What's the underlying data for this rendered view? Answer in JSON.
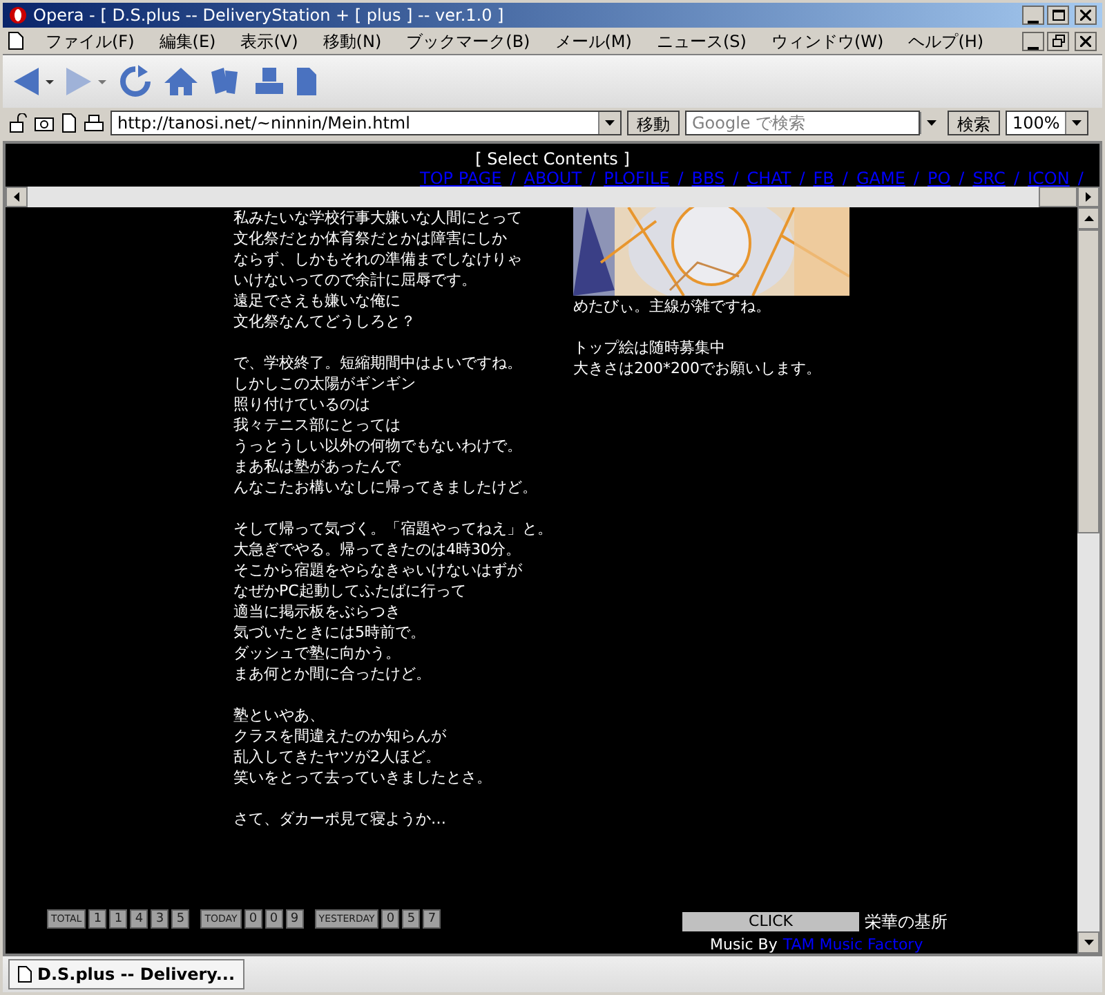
{
  "window": {
    "title": "Opera - [ D.S.plus -- DeliveryStation + [ plus ] -- ver.1.0 ]"
  },
  "menu": [
    "ファイル(F)",
    "編集(E)",
    "表示(V)",
    "移動(N)",
    "ブックマーク(B)",
    "メール(M)",
    "ニュース(S)",
    "ウィンドウ(W)",
    "ヘルプ(H)"
  ],
  "address_bar": {
    "url": "http://tanosi.net/~ninnin/Mein.html",
    "go_button": "移動",
    "search_placeholder": "Google で検索",
    "search_button": "検索",
    "zoom": "100%"
  },
  "top_frame": {
    "heading": "[ Select Contents ]",
    "links": [
      {
        "label": "TOP PAGE",
        "separator": "/"
      },
      {
        "label": "ABOUT",
        "separator": "/"
      },
      {
        "label": "PLOFILE",
        "separator": "/"
      },
      {
        "label": "BBS",
        "separator": "/"
      },
      {
        "label": "CHAT",
        "separator": "/"
      },
      {
        "label": "FB",
        "separator": "/"
      },
      {
        "label": "GAME",
        "separator": "/"
      },
      {
        "label": "PO",
        "separator": "/"
      },
      {
        "label": "SRC",
        "separator": "/"
      },
      {
        "label": "ICON",
        "separator": "/"
      }
    ]
  },
  "diary": [
    [
      "私みたいな学校行事大嫌いな人間にとって",
      "文化祭だとか体育祭だとかは障害にしか",
      "ならず、しかもそれの準備までしなけりゃ",
      "いけないってので余計に屈辱です。",
      "遠足でさえも嫌いな俺に",
      "文化祭なんてどうしろと？"
    ],
    [
      "で、学校終了。短縮期間中はよいですね。",
      "しかしこの太陽がギンギン",
      "照り付けているのは",
      "我々テニス部にとっては",
      "うっとうしい以外の何物でもないわけで。",
      "まあ私は塾があったんで",
      "んなこたお構いなしに帰ってきましたけど。"
    ],
    [
      "そして帰って気づく。「宿題やってねえ」と。",
      "大急ぎでやる。帰ってきたのは4時30分。",
      "そこから宿題をやらなきゃいけないはずが",
      "なぜかPC起動してふたばに行って",
      "適当に掲示板をぶらつき",
      "気づいたときには5時前で。",
      "ダッシュで塾に向かう。",
      "まあ何とか間に合ったけど。"
    ],
    [
      "塾といやあ、",
      "クラスを間違えたのか知らんが",
      "乱入してきたヤツが2人ほど。",
      "笑いをとって去っていきましたとさ。"
    ],
    [
      "さて、ダカーポ見て寝ようか…"
    ]
  ],
  "side": {
    "caption": "めたびぃ。主線が雑ですね。",
    "notes": [
      "トップ絵は随時募集中",
      "大きさは200*200でお願いします。"
    ]
  },
  "counters": [
    {
      "label": "TOTAL",
      "digits": [
        "1",
        "1",
        "4",
        "3",
        "5"
      ]
    },
    {
      "label": "TODAY",
      "digits": [
        "0",
        "0",
        "9"
      ]
    },
    {
      "label": "YESTERDAY",
      "digits": [
        "0",
        "5",
        "7"
      ]
    }
  ],
  "footer": {
    "click_button": "CLICK",
    "site_name": "栄華の基所",
    "music_prefix": "Music By",
    "music_link": "TAM Music Factory"
  },
  "tabs": [
    {
      "label": "D.S.plus -- Delivery...",
      "selected": true
    }
  ]
}
